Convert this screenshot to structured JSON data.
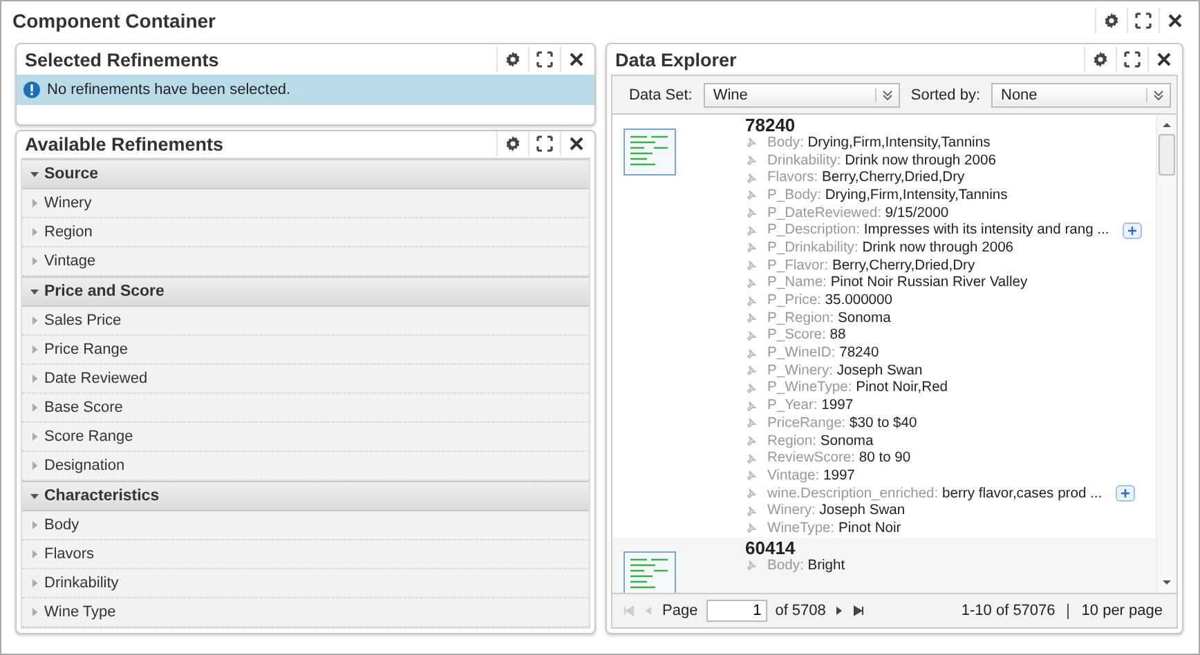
{
  "container": {
    "title": "Component Container"
  },
  "selected_refinements": {
    "title": "Selected Refinements",
    "message": "No refinements have been selected."
  },
  "available_refinements": {
    "title": "Available Refinements",
    "groups": [
      {
        "label": "Source",
        "expanded": true,
        "children": [
          {
            "label": "Winery",
            "expanded": false
          },
          {
            "label": "Region",
            "expanded": false
          },
          {
            "label": "Vintage",
            "expanded": false
          }
        ]
      },
      {
        "label": "Price and Score",
        "expanded": true,
        "children": [
          {
            "label": "Sales Price",
            "expanded": false
          },
          {
            "label": "Price Range",
            "expanded": false
          },
          {
            "label": "Date Reviewed",
            "expanded": false
          },
          {
            "label": "Base Score",
            "expanded": false
          },
          {
            "label": "Score Range",
            "expanded": false
          },
          {
            "label": "Designation",
            "expanded": false
          }
        ]
      },
      {
        "label": "Characteristics",
        "expanded": true,
        "children": [
          {
            "label": "Body",
            "expanded": false
          },
          {
            "label": "Flavors",
            "expanded": false
          },
          {
            "label": "Drinkability",
            "expanded": false
          },
          {
            "label": "Wine Type",
            "expanded": false
          }
        ]
      }
    ]
  },
  "data_explorer": {
    "title": "Data Explorer",
    "data_set_label": "Data Set:",
    "data_set": "Wine",
    "sorted_by_label": "Sorted by:",
    "sorted_by": "None",
    "records": [
      {
        "id": "78240",
        "fields": [
          {
            "name": "Body:",
            "value": "Drying,Firm,Intensity,Tannins",
            "more": false
          },
          {
            "name": "Drinkability:",
            "value": "Drink now through 2006",
            "more": false
          },
          {
            "name": "Flavors:",
            "value": "Berry,Cherry,Dried,Dry",
            "more": false
          },
          {
            "name": "P_Body:",
            "value": "Drying,Firm,Intensity,Tannins",
            "more": false
          },
          {
            "name": "P_DateReviewed:",
            "value": "9/15/2000",
            "more": false
          },
          {
            "name": "P_Description:",
            "value": "Impresses with its intensity and rang ...",
            "more": true
          },
          {
            "name": "P_Drinkability:",
            "value": "Drink now through 2006",
            "more": false
          },
          {
            "name": "P_Flavor:",
            "value": "Berry,Cherry,Dried,Dry",
            "more": false
          },
          {
            "name": "P_Name:",
            "value": "Pinot Noir Russian River Valley",
            "more": false
          },
          {
            "name": "P_Price:",
            "value": "35.000000",
            "more": false
          },
          {
            "name": "P_Region:",
            "value": "Sonoma",
            "more": false
          },
          {
            "name": "P_Score:",
            "value": "88",
            "more": false
          },
          {
            "name": "P_WineID:",
            "value": "78240",
            "more": false
          },
          {
            "name": "P_Winery:",
            "value": "Joseph Swan",
            "more": false
          },
          {
            "name": "P_WineType:",
            "value": "Pinot Noir,Red",
            "more": false
          },
          {
            "name": "P_Year:",
            "value": "1997",
            "more": false
          },
          {
            "name": "PriceRange:",
            "value": "$30 to $40",
            "more": false
          },
          {
            "name": "Region:",
            "value": "Sonoma",
            "more": false
          },
          {
            "name": "ReviewScore:",
            "value": "80 to 90",
            "more": false
          },
          {
            "name": "Vintage:",
            "value": "1997",
            "more": false
          },
          {
            "name": "wine.Description_enriched:",
            "value": "berry flavor,cases prod ...",
            "more": true
          },
          {
            "name": "Winery:",
            "value": "Joseph Swan",
            "more": false
          },
          {
            "name": "WineType:",
            "value": "Pinot Noir",
            "more": false
          }
        ]
      },
      {
        "id": "60414",
        "fields": [
          {
            "name": "Body:",
            "value": "Bright",
            "more": false
          }
        ]
      }
    ],
    "pager": {
      "first_disabled": true,
      "prev_disabled": true,
      "next_disabled": false,
      "last_disabled": false,
      "page_label": "Page",
      "page": "1",
      "of_pages": "of 5708",
      "range": "1-10 of 57076",
      "per_page": "10 per page"
    }
  }
}
